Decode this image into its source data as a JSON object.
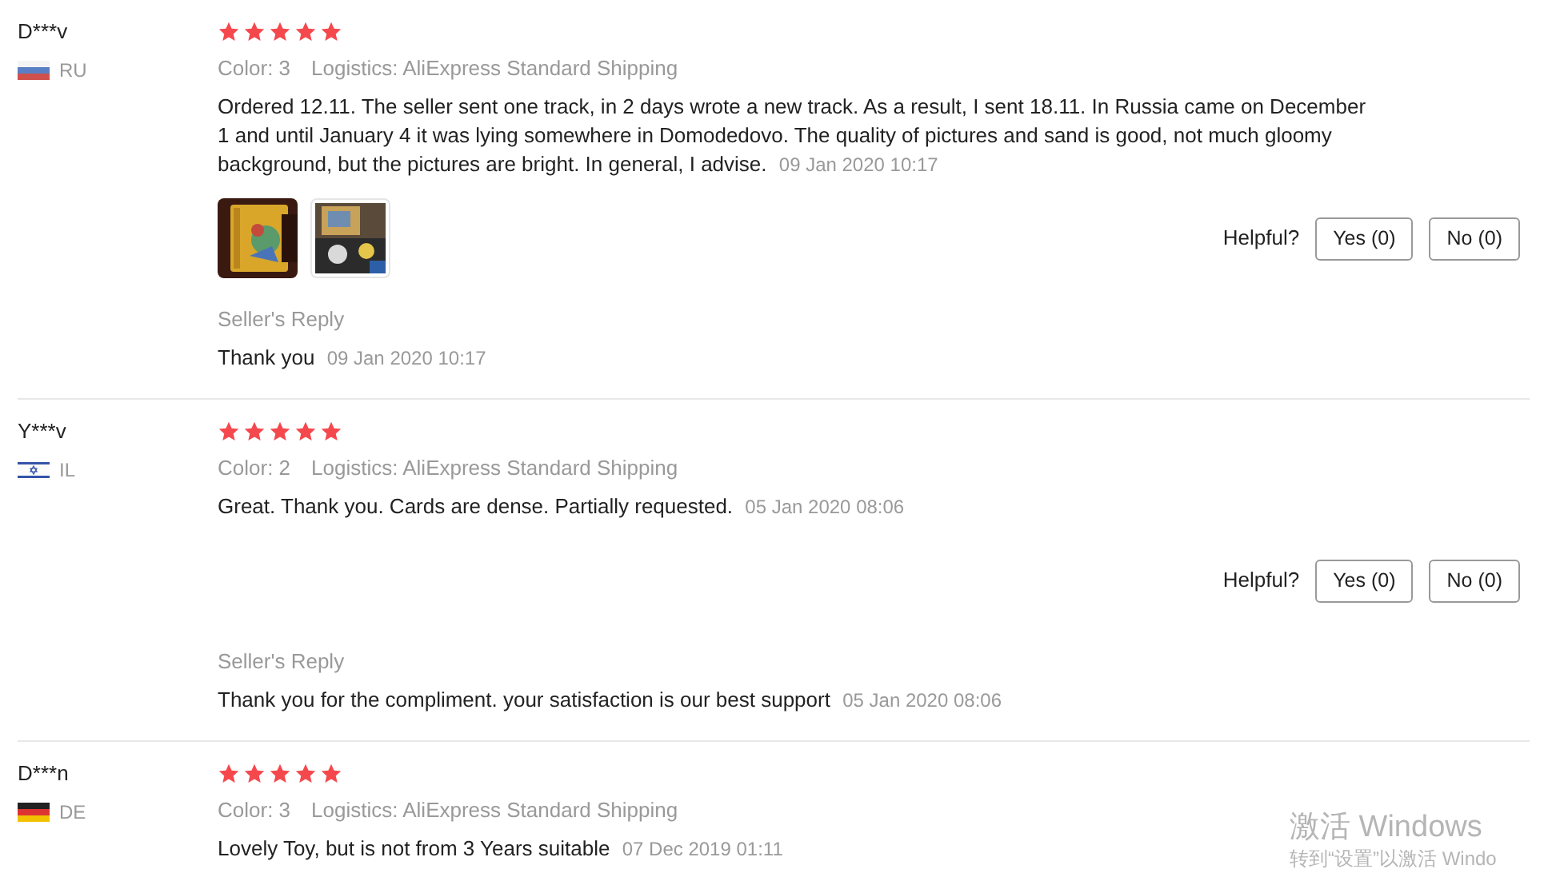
{
  "reviews": [
    {
      "name": "D***v",
      "flag": {
        "kind": "ru"
      },
      "country": "RU",
      "stars": 5,
      "variant": "Color: 3",
      "logistics": "Logistics: AliExpress Standard Shipping",
      "text": "Ordered 12.11. The seller sent one track, in 2 days wrote a new track. As a result, I sent 18.11. In Russia came on December 1 and until January 4 it was lying somewhere in Domodedovo. The quality of pictures and sand is good, not much gloomy background, but the pictures are bright. In general, I advise.",
      "date": "09 Jan 2020 10:17",
      "photos": [
        {
          "kind": "picture"
        },
        {
          "kind": "picture"
        }
      ],
      "helpful": {
        "label": "Helpful?",
        "yes": "Yes (0)",
        "no": "No (0)"
      },
      "reply": {
        "label": "Seller's Reply",
        "text": "Thank you",
        "date": "09 Jan 2020 10:17"
      }
    },
    {
      "name": "Y***v",
      "flag": {
        "kind": "il"
      },
      "country": "IL",
      "stars": 5,
      "variant": "Color: 2",
      "logistics": "Logistics: AliExpress Standard Shipping",
      "text": "Great. Thank you. Cards are dense. Partially requested.",
      "date": "05 Jan 2020 08:06",
      "helpful": {
        "label": "Helpful?",
        "yes": "Yes (0)",
        "no": "No (0)"
      },
      "reply": {
        "label": "Seller's Reply",
        "text": "Thank you for the compliment. your satisfaction is our best support",
        "date": "05 Jan 2020 08:06"
      }
    },
    {
      "name": "D***n",
      "flag": {
        "kind": "de"
      },
      "country": "DE",
      "stars": 5,
      "variant": "Color: 3",
      "logistics": "Logistics: AliExpress Standard Shipping",
      "text": "Lovely Toy, but is not from 3 Years suitable",
      "date": "07 Dec 2019 01:11"
    }
  ],
  "os_notice": {
    "title": "激活 Windows",
    "subtitle": "转到“设置”以激活 Windo"
  }
}
